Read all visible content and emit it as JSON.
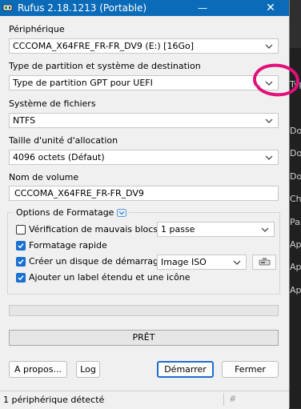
{
  "window": {
    "title": "Rufus 2.18.1213 (Portable)",
    "minimize_glyph": "—",
    "close_glyph": "✕"
  },
  "device": {
    "label": "Périphérique",
    "value": "CCCOMA_X64FRE_FR-FR_DV9 (E:) [16Go]"
  },
  "partition": {
    "label": "Type de partition et système de destination",
    "value": "Type de partition GPT pour UEFI"
  },
  "filesystem": {
    "label": "Système de fichiers",
    "value": "NTFS"
  },
  "cluster": {
    "label": "Taille d'unité d'allocation",
    "value": "4096 octets (Défaut)"
  },
  "volume": {
    "label": "Nom de volume",
    "value": "CCCOMA_X64FRE_FR-FR_DV9"
  },
  "format_options": {
    "title": "Options de Formatage",
    "bad_blocks": {
      "label": "Vérification de mauvais blocs",
      "checked": false,
      "passes": "1 passe"
    },
    "quick_format": {
      "label": "Formatage rapide",
      "checked": true
    },
    "bootable": {
      "label": "Créer un disque de démarrage",
      "checked": true,
      "type": "Image ISO"
    },
    "extended_label": {
      "label": "Ajouter un label étendu et une icône",
      "checked": true
    }
  },
  "progress": {
    "value": 0,
    "status": "PRÊT"
  },
  "buttons": {
    "about": "A propos...",
    "log": "Log",
    "start": "Démarrer",
    "close": "Fermer"
  },
  "statusbar": {
    "message": "1 périphérique détecté",
    "hash": "#"
  },
  "background_window": {
    "items": [
      "Type",
      "Do",
      "Do",
      "Do",
      "Ch",
      "Par",
      "Ap",
      "Ap",
      "Ap"
    ]
  },
  "colors": {
    "titlebar": "#0b6bb8",
    "accent": "#1a6fd1",
    "annotation": "#e0117a"
  },
  "icons": [
    "usb-drive-icon",
    "chevron-down-icon",
    "expand-toggle-icon",
    "checkmark-icon",
    "save-drive-icon"
  ]
}
